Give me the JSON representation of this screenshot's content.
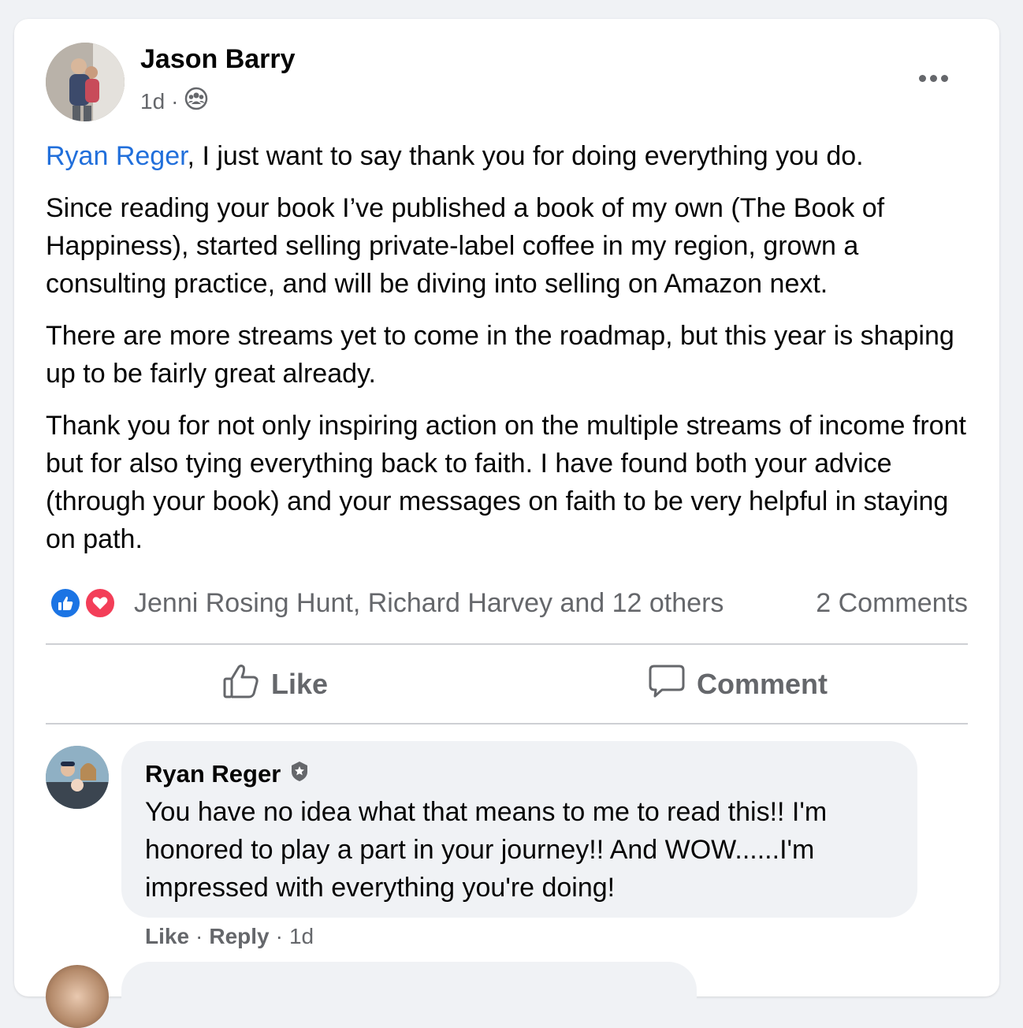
{
  "post": {
    "author": "Jason Barry",
    "time": "1d",
    "separator": "·",
    "audience_icon": "group-icon",
    "more_icon": "ellipsis-icon",
    "mention": "Ryan Reger",
    "line1_rest": ", I just want to say thank you for doing everything you do.",
    "paragraph2": "Since reading your book I’ve published a book of my own (The Book of Happiness), started selling private-label coffee in my region, grown a consulting practice, and will be diving into selling on Amazon next.",
    "paragraph3": "There are more streams yet to come in the roadmap, but this year is shaping up to be fairly great already.",
    "paragraph4": "Thank you for not only inspiring action on the multiple streams of income front but for also tying everything back to faith. I have found both your advice (through your book) and your messages on faith to be very helpful in staying on path."
  },
  "reactions": {
    "names": "Jenni Rosing Hunt, Richard Harvey and 12 others",
    "comments_count": "2 Comments",
    "like_color": "#1b74e4",
    "love_color": "#f33e58"
  },
  "actions": {
    "like": "Like",
    "comment": "Comment"
  },
  "comment": {
    "author": "Ryan Reger",
    "badge_icon": "admin-badge-icon",
    "text": "You have no idea what that means to me to read this!! I'm honored to play a part in your journey!! And WOW......I'm impressed with everything you're doing!",
    "like": "Like",
    "reply": "Reply",
    "time": "1d",
    "separator": "·"
  },
  "colors": {
    "link": "#216fdb",
    "secondary_text": "#65676b",
    "bubble": "#f0f2f5"
  }
}
